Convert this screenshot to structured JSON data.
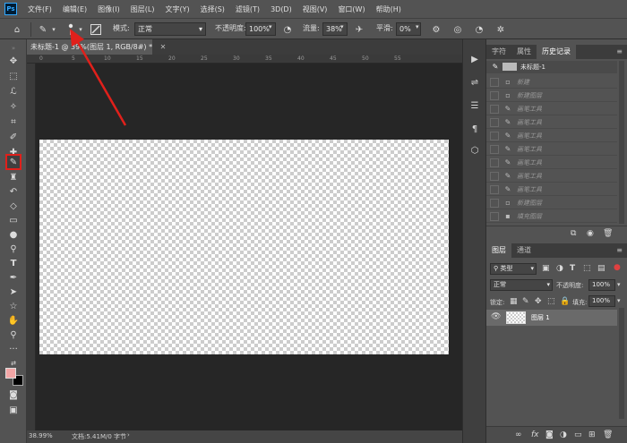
{
  "app": {
    "logo": "Ps"
  },
  "menu": [
    "文件(F)",
    "编辑(E)",
    "图像(I)",
    "图层(L)",
    "文字(Y)",
    "选择(S)",
    "滤镜(T)",
    "3D(D)",
    "视图(V)",
    "窗口(W)",
    "帮助(H)"
  ],
  "options": {
    "mode_label": "模式:",
    "mode_value": "正常",
    "opacity_label": "不透明度:",
    "opacity_value": "100%",
    "flow_label": "流量:",
    "flow_value": "38%",
    "smooth_label": "平滑:",
    "smooth_value": "0%"
  },
  "document": {
    "tab_title": "未标题-1 @ 39%(图层 1, RGB/8#) *",
    "zoom": "38.99%",
    "doc_size": "文档:5.41M/0 字节",
    "ruler_marks": [
      "0",
      "5",
      "10",
      "15",
      "20",
      "25",
      "30",
      "35",
      "40",
      "45",
      "50",
      "55"
    ]
  },
  "history_panel": {
    "tabs": [
      "字符",
      "属性",
      "历史记录"
    ],
    "selected_tab": "历史记录",
    "snapshot": "未标题-1",
    "items": [
      "新建",
      "新建图层",
      "画笔工具",
      "画笔工具",
      "画笔工具",
      "画笔工具",
      "画笔工具",
      "画笔工具",
      "画笔工具",
      "新建图层",
      "填充图层"
    ]
  },
  "layers_panel": {
    "tabs": [
      "图层",
      "通道"
    ],
    "selected_tab": "图层",
    "filter_label": "类型",
    "blend_mode": "正常",
    "opacity_label": "不透明度:",
    "opacity_value": "100%",
    "lock_label": "锁定:",
    "fill_label": "填充:",
    "fill_value": "100%",
    "layers": [
      {
        "name": "图层 1"
      }
    ]
  },
  "colors": {
    "accent_red": "#e0201b",
    "foreground": "#f2a6a6",
    "background": "#000000"
  }
}
